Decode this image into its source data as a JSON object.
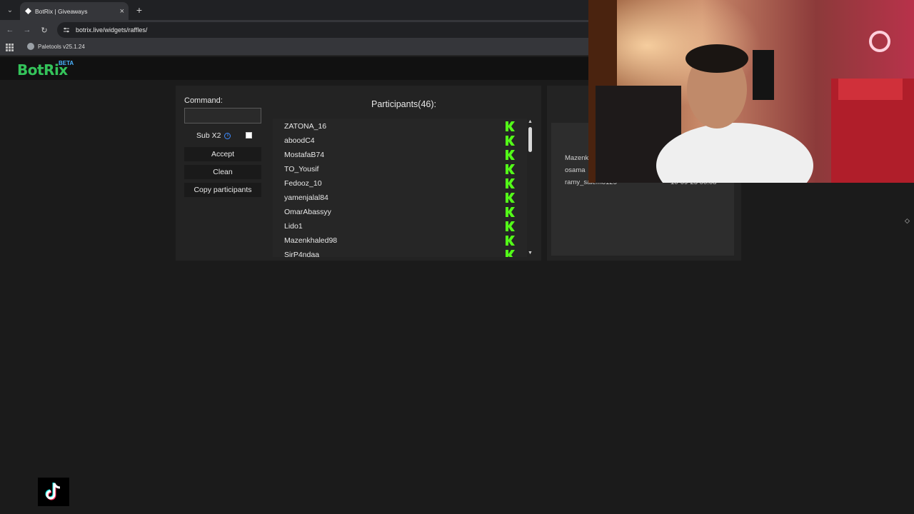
{
  "browser": {
    "tab_title": "BotRix | Giveaways",
    "tab_close": "×",
    "new_tab": "+",
    "url": "botrix.live/widgets/raffles/",
    "bookmark": "Paletools v25.1.24"
  },
  "app": {
    "logo": "BotRix",
    "badge": "BETA"
  },
  "form": {
    "command_label": "Command:",
    "command_value": "",
    "subx2_label": "Sub X2",
    "subx2_checked": false,
    "accept_label": "Accept",
    "clean_label": "Clean",
    "copy_label": "Copy participants"
  },
  "participants": {
    "title": "Participants(46):",
    "items": [
      "ZATONA_16",
      "aboodC4",
      "MostafaB74",
      "TO_Yousif",
      "Fedooz_10",
      "yamenjalal84",
      "OmarAbassyy",
      "Lido1",
      "Mazenkhaled98",
      "SirP4ndaa"
    ],
    "platform_icon": "kick-icon",
    "platform_color": "#53fc18"
  },
  "winners": {
    "rows": [
      {
        "name": "Mazenk",
        "date": ""
      },
      {
        "name": "osama",
        "date": ""
      },
      {
        "name": "ramy_salemo125",
        "date": "10-09-25 00:08"
      }
    ]
  },
  "colors": {
    "accent": "#34c35a",
    "beta": "#4ab3ff",
    "info": "#3d8bff"
  }
}
